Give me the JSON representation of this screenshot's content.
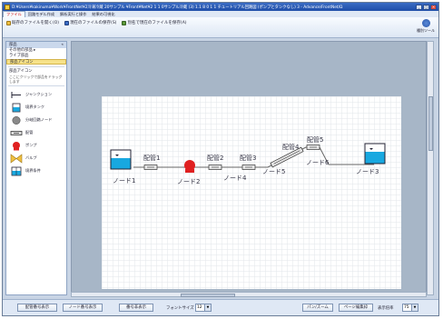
{
  "window": {
    "title": "D:¥Users¥kakinuma¥Work¥FrontNet¥2冷凍冷蔵 20サンプル ¥Front¥Net¥2 1 1 0サンプル冷蔵 (3) 1.1 8 0 1 1 チュートリアル回路図 (ポンプとタンクなし) 3 - Advance/FrontNet/Ω",
    "minimize": "_",
    "maximize": "□",
    "close": "×"
  },
  "ribbon": {
    "tabs": [
      "ファイル",
      "回路モデル作成",
      "解析実行と操作",
      "結果の可視化"
    ],
    "items": [
      "既存のファイルを開く(O)",
      "現在のファイルの保存(S)",
      "別名で現在のファイルを保存(A)"
    ],
    "help_label": "種別ツール"
  },
  "left_panel": {
    "title": "部品",
    "collapse": "«",
    "nav": [
      "その他の部品 ▸",
      "ライブ部品",
      "部品アイコン"
    ],
    "section_title": "部品アイコン",
    "section_desc": "ここにクリックで部品をドラッグします",
    "icons": [
      {
        "label": "ジャンクション"
      },
      {
        "label": "境界タンク"
      },
      {
        "label": "分岐回路ノード"
      },
      {
        "label": "配管"
      },
      {
        "label": "ポンプ"
      },
      {
        "label": "バルブ"
      },
      {
        "label": "境界条件"
      }
    ]
  },
  "diagram": {
    "nodes": [
      "ノード1",
      "ノード2",
      "ノード4",
      "ノード5",
      "ノード6",
      "ノード3"
    ],
    "pipes": [
      "配管1",
      "配管2",
      "配管3",
      "配管4",
      "配管5"
    ]
  },
  "bottom_bar": {
    "btn_pipe_numbers": "配管番号表示",
    "btn_node_numbers": "ノード番号表示",
    "btn_component_numbers": "番号非表示",
    "font_size_label": "フォントサイズ",
    "font_size_value": "12",
    "btn_pan_zoom": "パン/ズーム",
    "btn_page_edit": "ページ編集枠",
    "zoom_label": "表示倍率",
    "zoom_value": "75"
  },
  "colors": {
    "pump": "#e02020",
    "tank_water": "#18a8e0",
    "pipe": "#777777",
    "accent": "#f6e28a"
  }
}
